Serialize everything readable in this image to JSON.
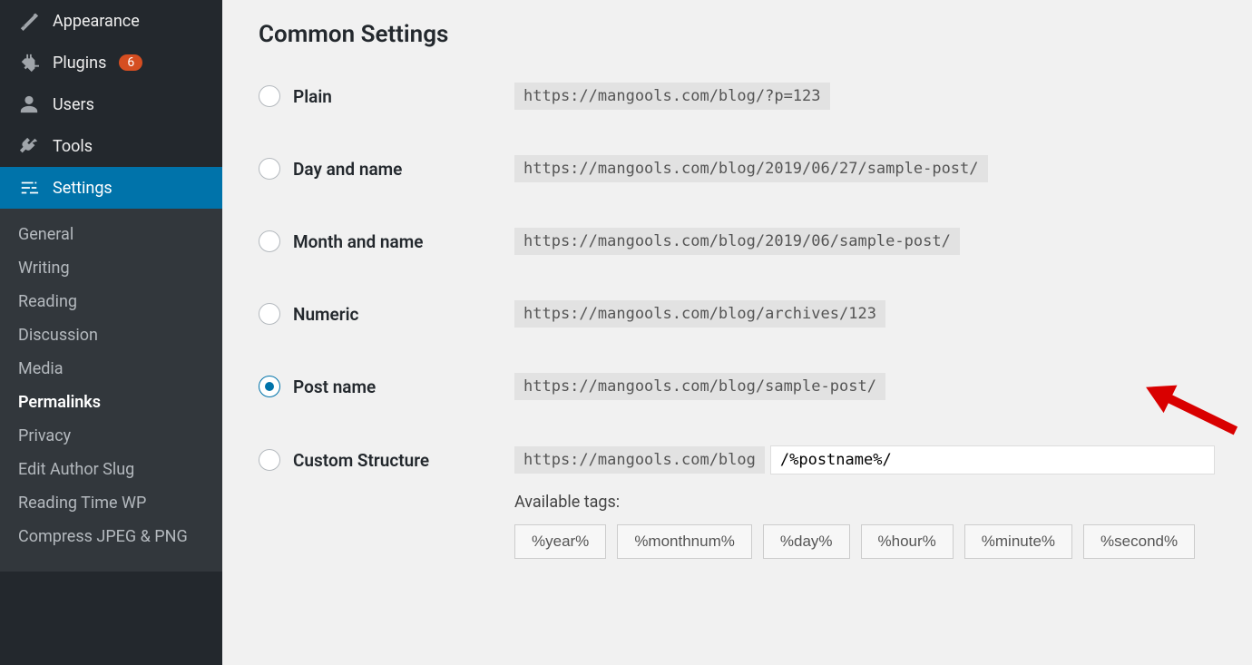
{
  "sidebar": {
    "items": [
      {
        "label": "Appearance",
        "icon": "appearance-icon",
        "key": "appearance"
      },
      {
        "label": "Plugins",
        "icon": "plugins-icon",
        "badge": "6",
        "key": "plugins"
      },
      {
        "label": "Users",
        "icon": "users-icon",
        "key": "users"
      },
      {
        "label": "Tools",
        "icon": "tools-icon",
        "key": "tools"
      },
      {
        "label": "Settings",
        "icon": "settings-icon",
        "key": "settings",
        "active": true
      }
    ],
    "subitems": [
      "General",
      "Writing",
      "Reading",
      "Discussion",
      "Media",
      "Permalinks",
      "Privacy",
      "Edit Author Slug",
      "Reading Time WP",
      "Compress JPEG & PNG"
    ],
    "current_subitem": "Permalinks"
  },
  "main": {
    "heading": "Common Settings",
    "options": [
      {
        "label": "Plain",
        "example": "https://mangools.com/blog/?p=123",
        "checked": false
      },
      {
        "label": "Day and name",
        "example": "https://mangools.com/blog/2019/06/27/sample-post/",
        "checked": false
      },
      {
        "label": "Month and name",
        "example": "https://mangools.com/blog/2019/06/sample-post/",
        "checked": false
      },
      {
        "label": "Numeric",
        "example": "https://mangools.com/blog/archives/123",
        "checked": false
      },
      {
        "label": "Post name",
        "example": "https://mangools.com/blog/sample-post/",
        "checked": true
      },
      {
        "label": "Custom Structure",
        "example": "https://mangools.com/blog",
        "checked": false,
        "input_value": "/%postname%/"
      }
    ],
    "available_tags_label": "Available tags:",
    "tags": [
      "%year%",
      "%monthnum%",
      "%day%",
      "%hour%",
      "%minute%",
      "%second%"
    ]
  },
  "colors": {
    "accent": "#0073aa",
    "badge": "#d54e21",
    "sidebar_bg": "#23282d",
    "arrow": "#d90000"
  }
}
